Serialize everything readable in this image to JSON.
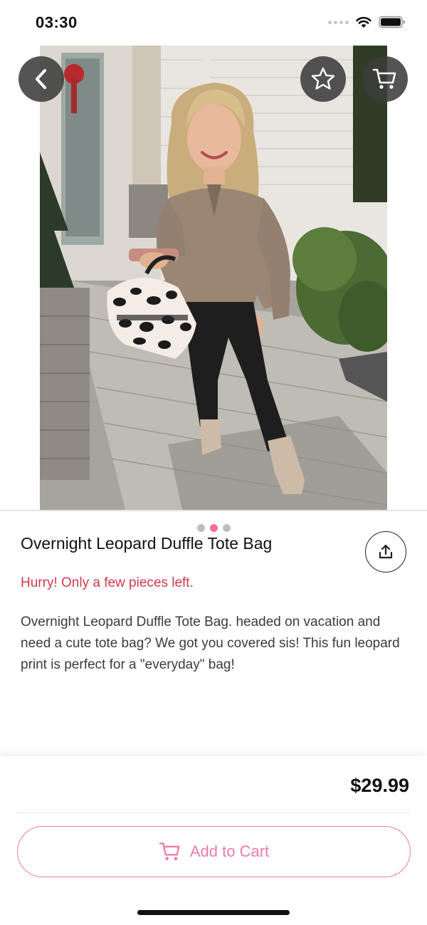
{
  "status_bar": {
    "time": "03:30"
  },
  "product": {
    "title": "Overnight Leopard Duffle Tote Bag",
    "stock_notice": "Hurry! Only a few pieces left.",
    "description": "Overnight Leopard Duffle Tote Bag. headed on vacation and need a cute tote bag? We got you covered sis! This fun leopard print is perfect for a \"everyday\" bag!",
    "price": "$29.99"
  },
  "gallery": {
    "image_count": 3,
    "active_index": 1
  },
  "actions": {
    "add_to_cart_label": "Add to Cart"
  },
  "icons": {
    "back": "chevron-left-icon",
    "favorite": "star-icon",
    "cart": "cart-icon",
    "share": "share-icon"
  },
  "colors": {
    "accent": "#f07aa6",
    "stock_warning": "#d0394d",
    "nav_button_bg": "#3c3c3c"
  }
}
